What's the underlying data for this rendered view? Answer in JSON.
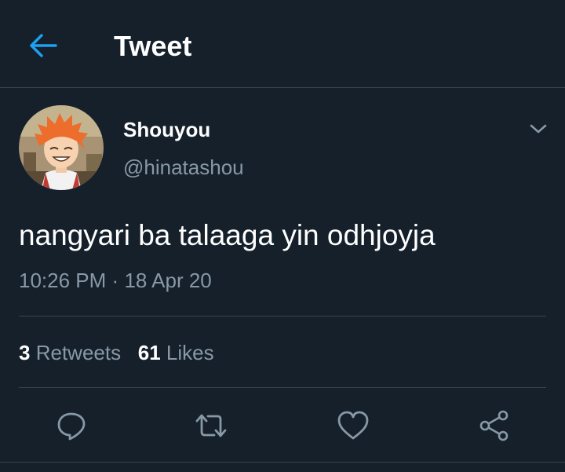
{
  "header": {
    "title": "Tweet",
    "back_icon": "arrow-left-icon"
  },
  "tweet": {
    "author": {
      "display_name": "Shouyou",
      "handle": "@hinatashou",
      "avatar": "avatar-orange-haired-character"
    },
    "text": "nangyari ba talaaga yin odhjoyja",
    "time": "10:26 PM",
    "separator": "·",
    "date": "18 Apr 20",
    "stats": {
      "retweets_count": "3",
      "retweets_label": "Retweets",
      "likes_count": "61",
      "likes_label": "Likes"
    },
    "actions": [
      "reply-icon",
      "retweet-icon",
      "like-icon",
      "share-icon"
    ]
  },
  "colors": {
    "background": "#15202b",
    "accent": "#1da1f2",
    "secondary_text": "#8899a6",
    "divider": "#38444d"
  }
}
